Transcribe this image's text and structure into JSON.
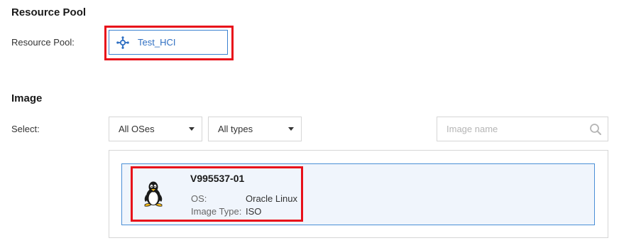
{
  "resource_pool_section": {
    "title": "Resource Pool",
    "label": "Resource Pool:",
    "selected_pool": "Test_HCI",
    "pool_icon": "cluster-icon"
  },
  "image_section": {
    "title": "Image",
    "select_label": "Select:",
    "os_filter": {
      "selected": "All OSes"
    },
    "type_filter": {
      "selected": "All types"
    },
    "search": {
      "placeholder": "Image name",
      "value": ""
    },
    "images": [
      {
        "name": "V995537-01",
        "icon": "linux-penguin-icon",
        "os_label": "OS:",
        "os_value": "Oracle Linux",
        "type_label": "Image Type:",
        "type_value": "ISO",
        "selected": true
      }
    ]
  },
  "colors": {
    "accent": "#3b82d1",
    "highlight": "#e8101a",
    "selected_bg": "#f0f5fc"
  }
}
